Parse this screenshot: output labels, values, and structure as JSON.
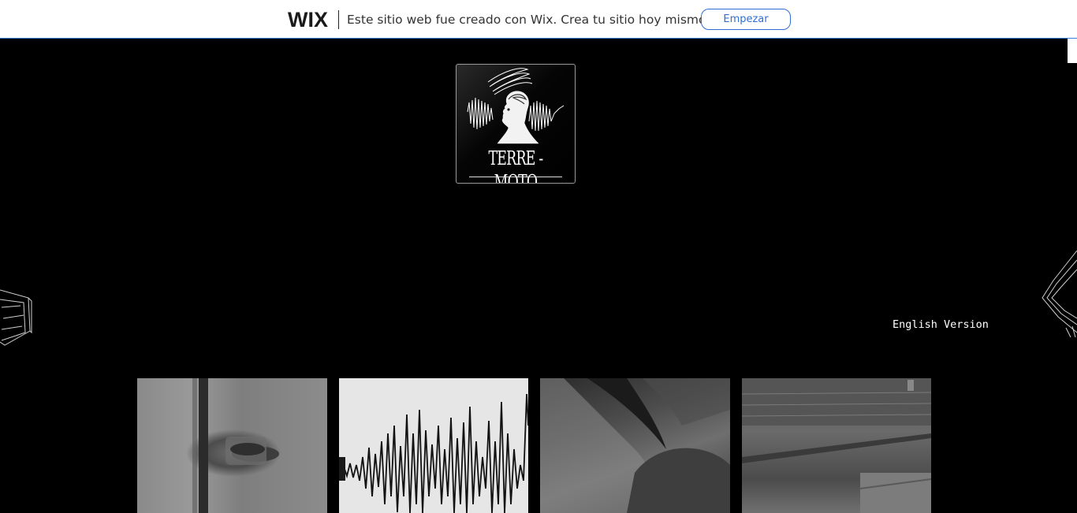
{
  "wix_banner": {
    "logo": "WIX",
    "message": "Este sitio web fue creado con Wix. Crea tu sitio hoy mismo.",
    "button_label": "Empezar"
  },
  "logo": {
    "title": "TERRE - MOTO"
  },
  "language_link": "English Version",
  "gallery": {
    "items": [
      {
        "description": "door handle"
      },
      {
        "description": "seismograph wave"
      },
      {
        "description": "person portrait"
      },
      {
        "description": "interior scene"
      }
    ]
  },
  "colors": {
    "background": "#000000",
    "banner_bg": "#ffffff",
    "accent": "#2f6fd4"
  }
}
